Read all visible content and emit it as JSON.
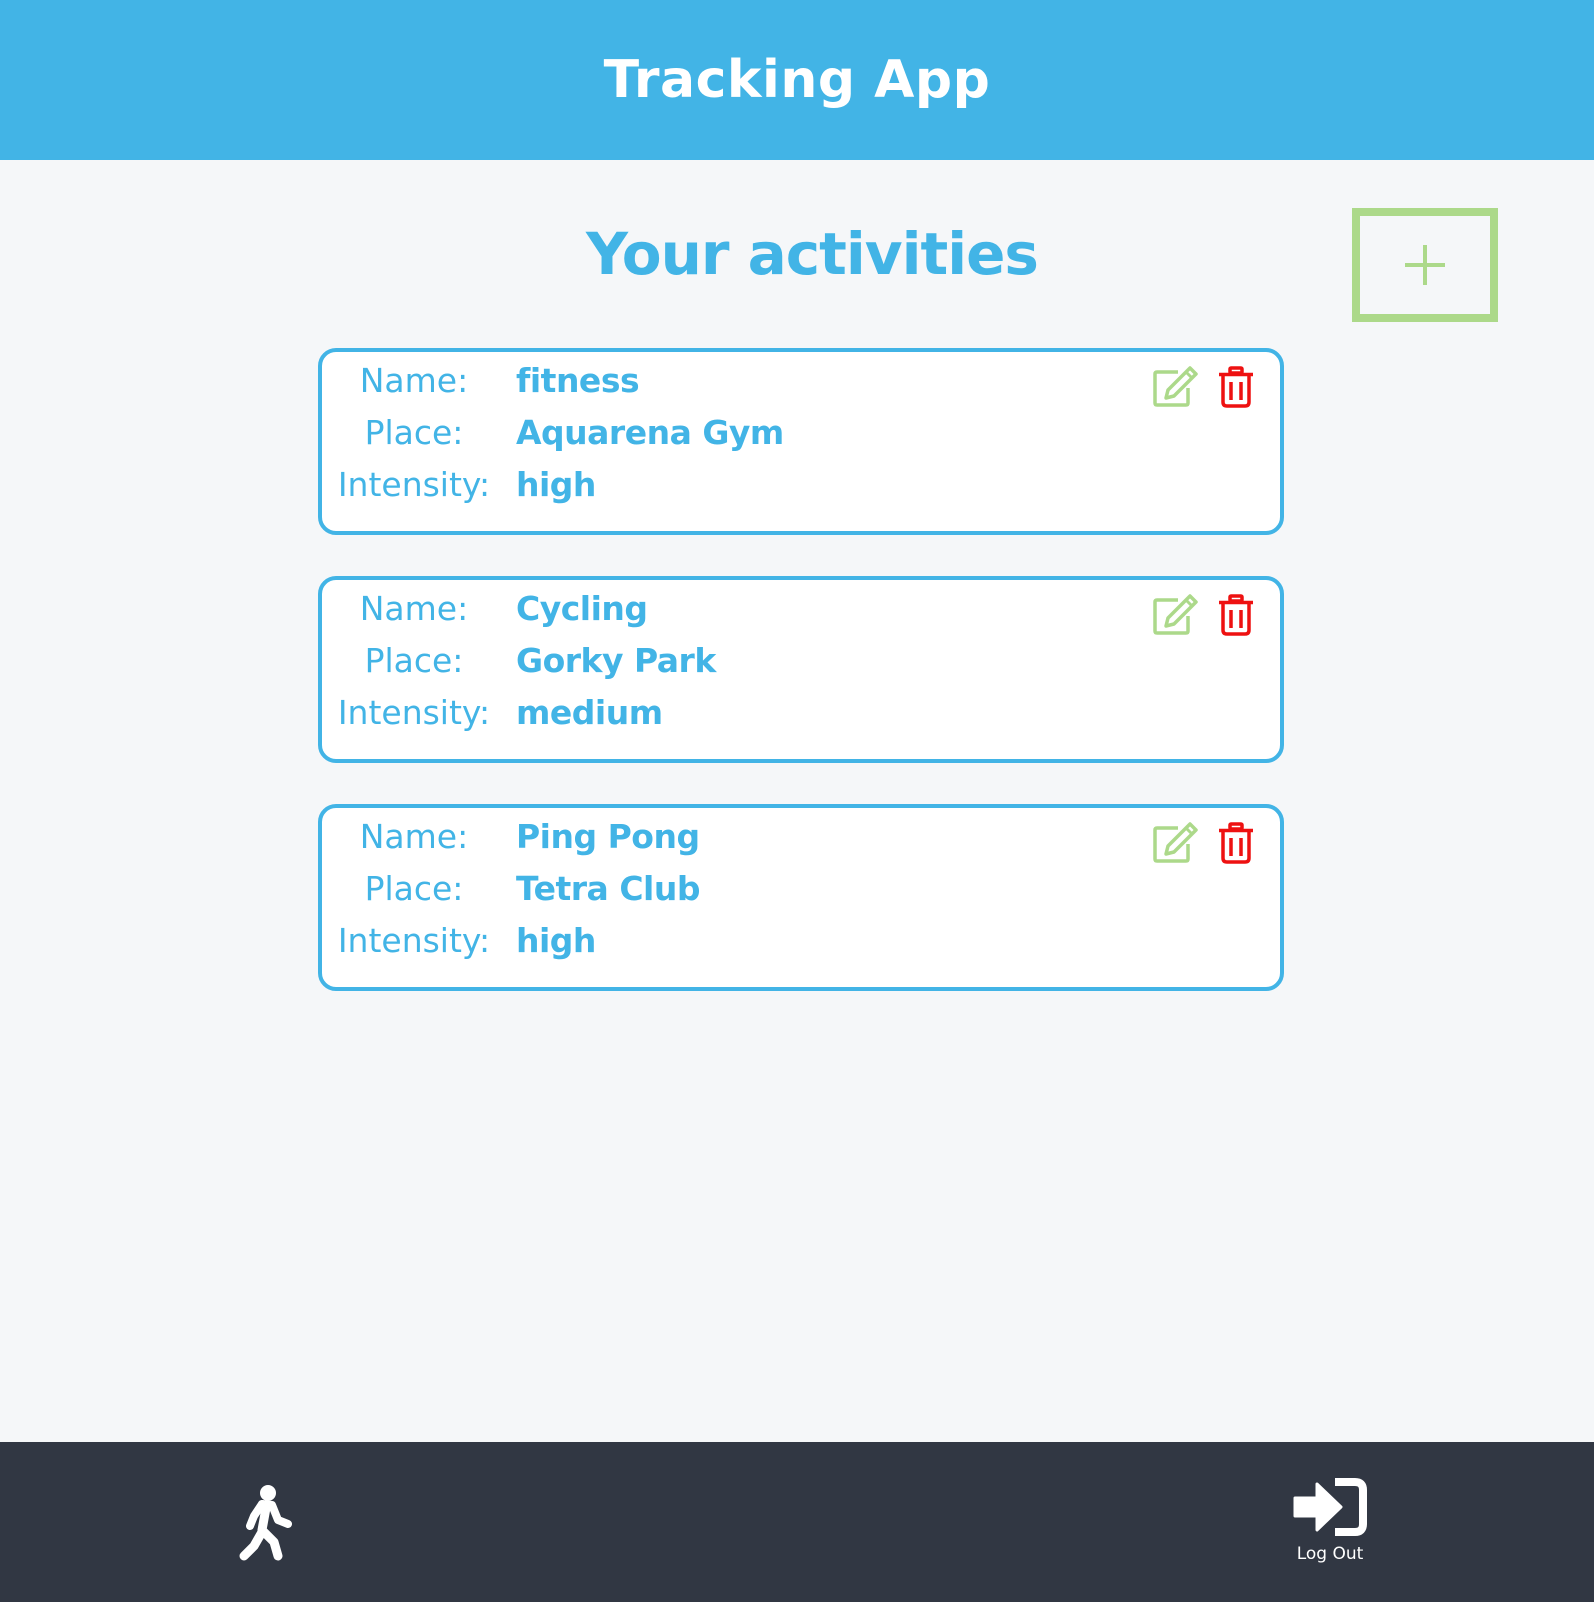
{
  "header": {
    "title": "Tracking App"
  },
  "main": {
    "heading": "Your activities",
    "add_button_symbol": "+",
    "field_labels": {
      "name": "Name:",
      "place": "Place:",
      "intensity": "Intensity:"
    },
    "activities": [
      {
        "name": "fitness",
        "place": "Aquarena Gym",
        "intensity": "high"
      },
      {
        "name": "Cycling",
        "place": "Gorky Park",
        "intensity": "medium"
      },
      {
        "name": "Ping Pong",
        "place": "Tetra Club",
        "intensity": "high"
      }
    ]
  },
  "footer": {
    "activities_nav_icon": "walking-person-icon",
    "logout_icon": "sign-in-arrow-icon",
    "logout_label": "Log Out"
  },
  "colors": {
    "primary": "#42b4e6",
    "header_bg": "#42b4e6",
    "footer_bg": "#313743",
    "edit": "#acd98a",
    "delete": "#ee1111",
    "page_bg": "#f5f7f9"
  }
}
